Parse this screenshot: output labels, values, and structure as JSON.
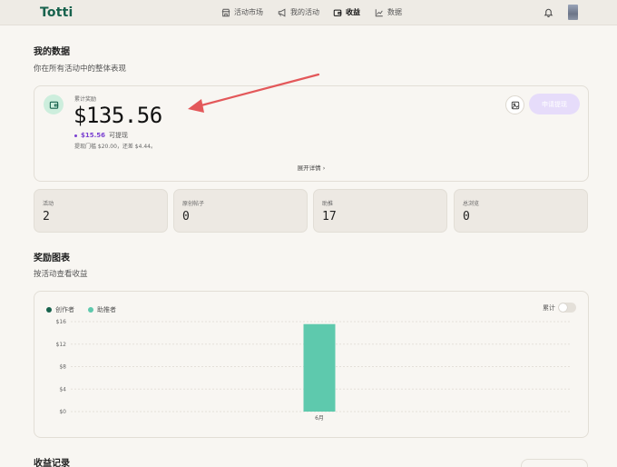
{
  "app": {
    "logo": "Totti"
  },
  "nav": {
    "items": [
      {
        "label": "活动市场",
        "icon": "store-icon"
      },
      {
        "label": "我的活动",
        "icon": "megaphone-icon"
      },
      {
        "label": "收益",
        "icon": "wallet-icon",
        "active": true
      },
      {
        "label": "数据",
        "icon": "chart-icon"
      }
    ]
  },
  "my_data": {
    "title": "我的数据",
    "subtitle": "你在所有活动中的整体表现"
  },
  "summary": {
    "label": "累计奖励",
    "amount": "$135.56",
    "withdrawable_amount": "$15.56",
    "withdrawable_label": "可提现",
    "threshold_text": "提现门槛 $20.00，还差 $4.44。",
    "expand_label": "展开详情 ›",
    "apply_button": "申请提现"
  },
  "stats": [
    {
      "label": "活动",
      "value": "2"
    },
    {
      "label": "原创帖子",
      "value": "0"
    },
    {
      "label": "助推",
      "value": "17"
    },
    {
      "label": "总浏览",
      "value": "0"
    }
  ],
  "rewards_chart": {
    "title": "奖励图表",
    "subtitle": "按活动查看收益",
    "cumulative_label": "累计"
  },
  "colors": {
    "creator": "#17624d",
    "booster": "#5ec9ad",
    "accent_purple": "#7a3fd1"
  },
  "chart_data": {
    "type": "bar",
    "categories": [
      "6月"
    ],
    "series": [
      {
        "name": "创作者",
        "values": [
          0
        ]
      },
      {
        "name": "助推者",
        "values": [
          15.56
        ]
      }
    ],
    "yticks": [
      "$0",
      "$4",
      "$8",
      "$12",
      "$16"
    ],
    "ylim": [
      0,
      16
    ],
    "stacked": true,
    "grid": true,
    "legend": "top-left"
  },
  "history": {
    "title": "收益记录"
  }
}
